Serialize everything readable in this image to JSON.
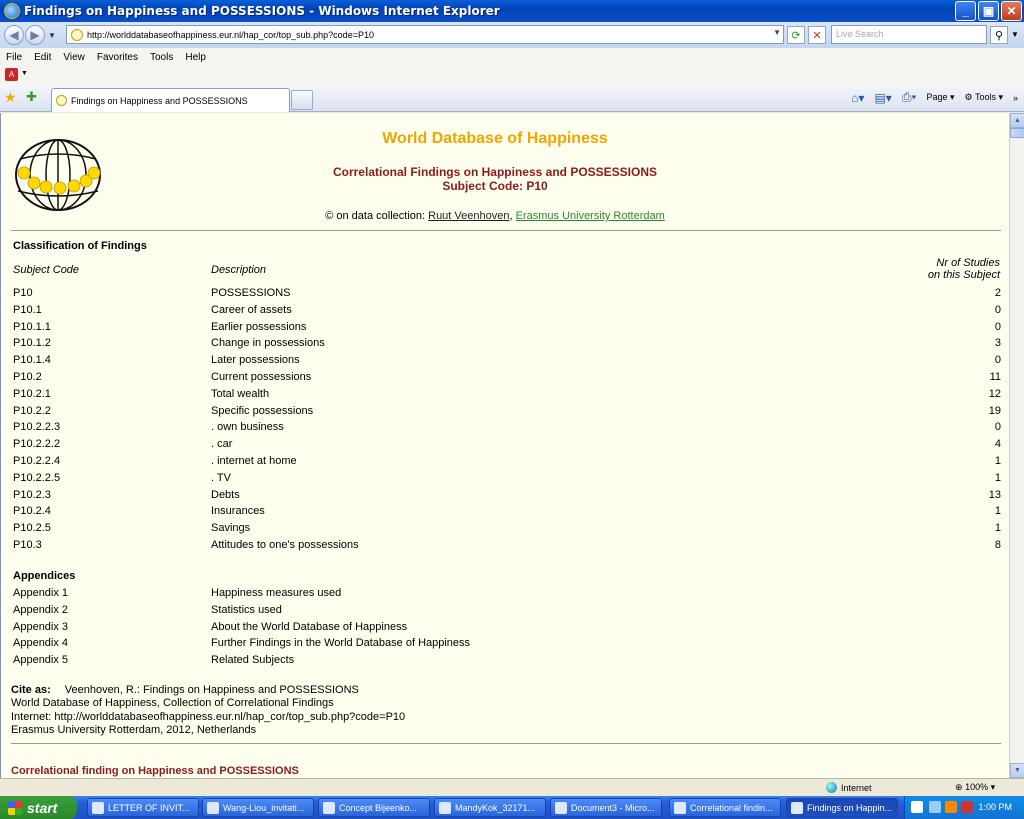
{
  "window": {
    "title": "Findings on Happiness and POSSESSIONS - Windows Internet Explorer",
    "minimize": "_",
    "maximize": "▣",
    "close": "✕"
  },
  "address_bar": {
    "url": "http://worlddatabaseofhappiness.eur.nl/hap_cor/top_sub.php?code=P10",
    "search_placeholder": "Live Search"
  },
  "menu": [
    "File",
    "Edit",
    "View",
    "Favorites",
    "Tools",
    "Help"
  ],
  "tab": {
    "label": "Findings on Happiness and POSSESSIONS"
  },
  "command_bar": {
    "page": "Page",
    "tools": "Tools"
  },
  "page": {
    "site_title": "World Database of Happiness",
    "subtitle": "Correlational Findings on Happiness and POSSESSIONS",
    "subject_code": "Subject Code: P10",
    "copyright_prefix": "© on data collection:",
    "author_link": "Ruut Veenhoven",
    "university_link": "Erasmus University Rotterdam",
    "classification_heading": "Classification of Findings",
    "col_subject_code": "Subject Code",
    "col_description": "Description",
    "col_nr_line1": "Nr of Studies",
    "col_nr_line2": "on this Subject",
    "rows": [
      {
        "code": "P10",
        "desc": "POSSESSIONS",
        "num": "2"
      },
      {
        "code": "P10.1",
        "desc": "Career of assets",
        "num": "0"
      },
      {
        "code": "P10.1.1",
        "desc": "Earlier possessions",
        "num": "0"
      },
      {
        "code": "P10.1.2",
        "desc": "Change in possessions",
        "num": "3"
      },
      {
        "code": "P10.1.4",
        "desc": "Later possessions",
        "num": "0"
      },
      {
        "code": "P10.2",
        "desc": "Current possessions",
        "num": "11"
      },
      {
        "code": "P10.2.1",
        "desc": "Total wealth",
        "num": "12"
      },
      {
        "code": "P10.2.2",
        "desc": "Specific possessions",
        "num": "19"
      },
      {
        "code": "P10.2.2.3",
        "desc": ". own business",
        "num": "0"
      },
      {
        "code": "P10.2.2.2",
        "desc": ". car",
        "num": "4"
      },
      {
        "code": "P10.2.2.4",
        "desc": ". internet at home",
        "num": "1"
      },
      {
        "code": "P10.2.2.5",
        "desc": ". TV",
        "num": "1"
      },
      {
        "code": "P10.2.3",
        "desc": "Debts",
        "num": "13"
      },
      {
        "code": "P10.2.4",
        "desc": "Insurances",
        "num": "1"
      },
      {
        "code": "P10.2.5",
        "desc": "Savings",
        "num": "1"
      },
      {
        "code": "P10.3",
        "desc": "Attitudes to one's possessions",
        "num": "8"
      }
    ],
    "appendices_heading": "Appendices",
    "appendices": [
      {
        "code": "Appendix 1",
        "desc": "Happiness measures used"
      },
      {
        "code": "Appendix 2",
        "desc": "Statistics used"
      },
      {
        "code": "Appendix 3",
        "desc": "About the World Database of Happiness"
      },
      {
        "code": "Appendix 4",
        "desc": "Further Findings in the World Database of Happiness"
      },
      {
        "code": "Appendix 5",
        "desc": "Related Subjects"
      }
    ],
    "cite_label": "Cite as:",
    "cite_line1": "Veenhoven, R.: Findings on Happiness and POSSESSIONS",
    "cite_line2": "World Database of Happiness, Collection of Correlational Findings",
    "cite_line3": "Internet: http://worlddatabaseofhappiness.eur.nl/hap_cor/top_sub.php?code=P10",
    "cite_line4": "Erasmus University Rotterdam, 2012, Netherlands",
    "bottom_heading": "Correlational finding on Happiness and POSSESSIONS"
  },
  "status_bar": {
    "zone": "Internet",
    "zoom": "100%"
  },
  "taskbar": {
    "start": "start",
    "tasks": [
      "LETTER OF INVIT...",
      "Wang-Liou_invitati...",
      "Concept Bijeenko...",
      "MandyKok_32171...",
      "Document3 - Micro...",
      "Correlational findin...",
      "Findings on Happin..."
    ],
    "clock": "1:00 PM"
  },
  "colors": {
    "site_title": "#f0a500",
    "subtitle": "#8b1a1a",
    "page_bg": "#fffff0",
    "link_green": "#2a8a2a"
  }
}
